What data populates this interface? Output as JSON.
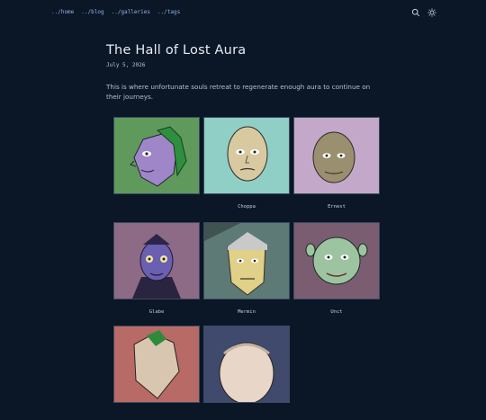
{
  "nav": {
    "home": "../home",
    "blog": "../blog",
    "galleries": "../galleries",
    "tags": "../tags"
  },
  "header": {
    "search_icon": "search-icon",
    "theme_icon": "sun-icon"
  },
  "page": {
    "title": "The Hall of Lost Aura",
    "date": "July 5, 2026",
    "intro": "This is where unfortunate souls retreat to regenerate enough aura to continue on their journeys."
  },
  "gallery": [
    {
      "caption": "",
      "bg": "#5f9a5c"
    },
    {
      "caption": "Choppa",
      "bg": "#8fcfc6"
    },
    {
      "caption": "Ernest",
      "bg": "#c3a8c9"
    },
    {
      "caption": "Glabe",
      "bg": "#8d6a86"
    },
    {
      "caption": "Mermin",
      "bg": "#5d7a77"
    },
    {
      "caption": "Unct",
      "bg": "#7b5d72"
    },
    {
      "caption": "",
      "bg": "#b86a66"
    },
    {
      "caption": "",
      "bg": "#3f4a6c"
    }
  ]
}
